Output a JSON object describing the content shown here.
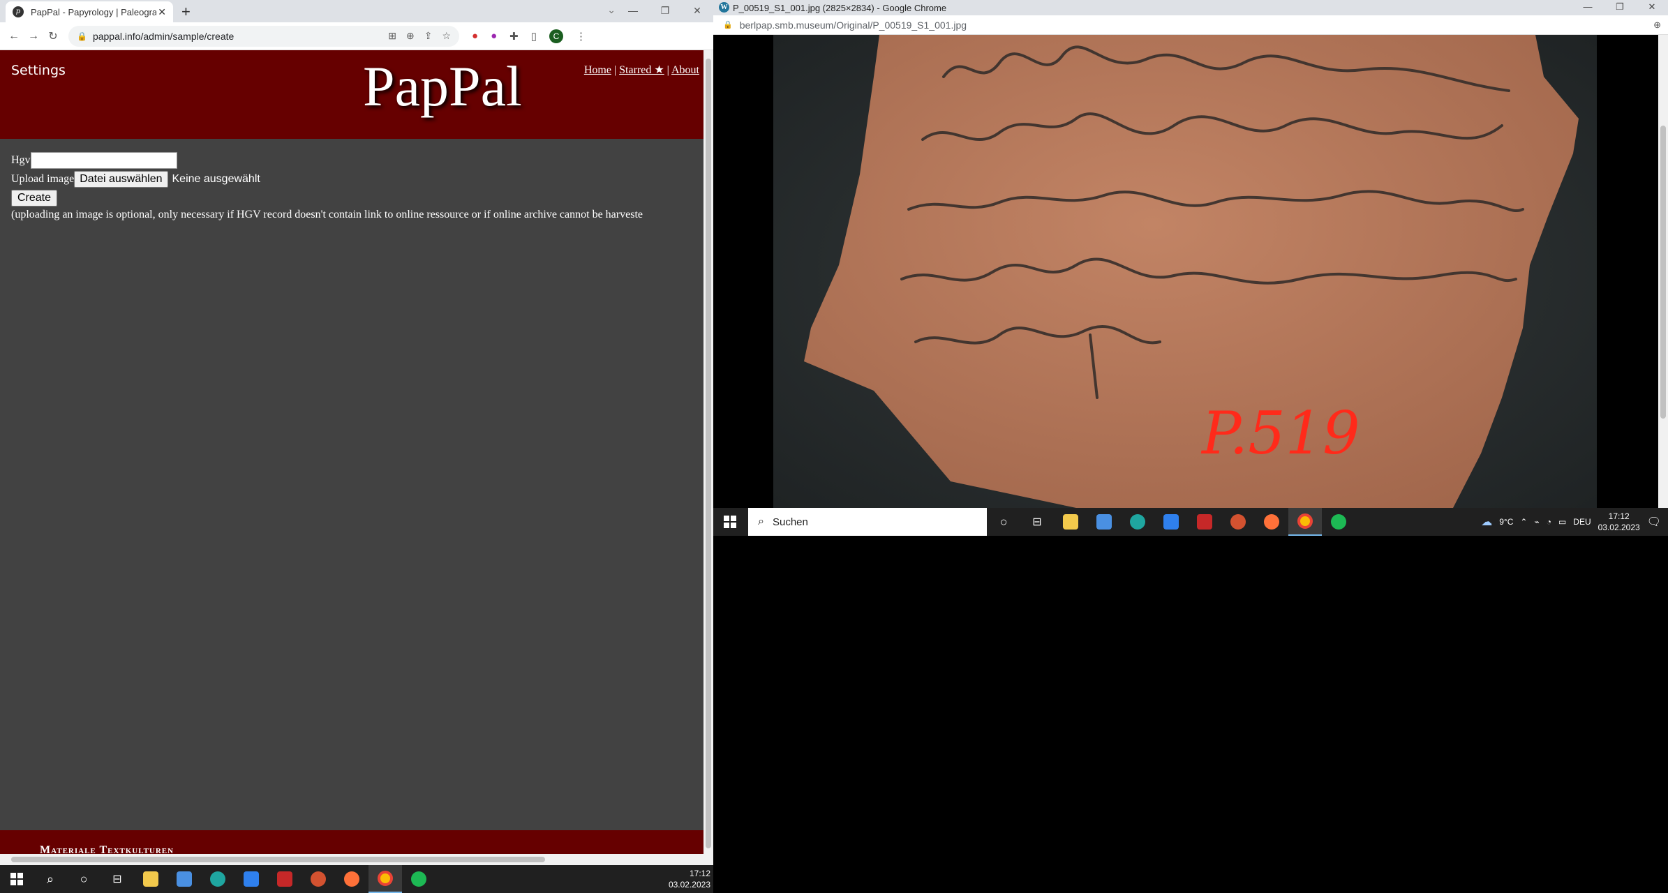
{
  "left_window": {
    "tab_title": "PapPal - Papyrology | Paleograph",
    "tab_favicon": "pappal-icon",
    "url": "pappal.info/admin/sample/create",
    "profile_initial": "C",
    "page": {
      "settings_label": "Settings",
      "logo_text": "PapPal",
      "nav": {
        "home": "Home",
        "sep1": "|",
        "starred": "Starred ★",
        "sep2": "|",
        "about": "About"
      },
      "form": {
        "hgv_label": "Hgv",
        "upload_label": "Upload image",
        "file_button": "Datei auswählen",
        "no_file": "Keine ausgewählt",
        "create_button": "Create",
        "note": "(uploading an image is optional, only necessary if HGV record doesn't contain link to online ressource or if online archive cannot be harveste"
      },
      "footer_text": "Materiale Textkulturen"
    },
    "taskbar_clock": {
      "time": "17:12",
      "date": "03.02.2023"
    }
  },
  "right_window": {
    "title": "P_00519_S1_001.jpg (2825×2834) - Google Chrome",
    "url": "berlpap.smb.museum/Original/P_00519_S1_001.jpg",
    "image_label": "P.519",
    "taskbar": {
      "search_placeholder": "Suchen",
      "weather": "9°C",
      "lang": "DEU",
      "time": "17:12",
      "date": "03.02.2023"
    }
  },
  "colors": {
    "header_red": "#660000",
    "page_gray": "#424242"
  }
}
